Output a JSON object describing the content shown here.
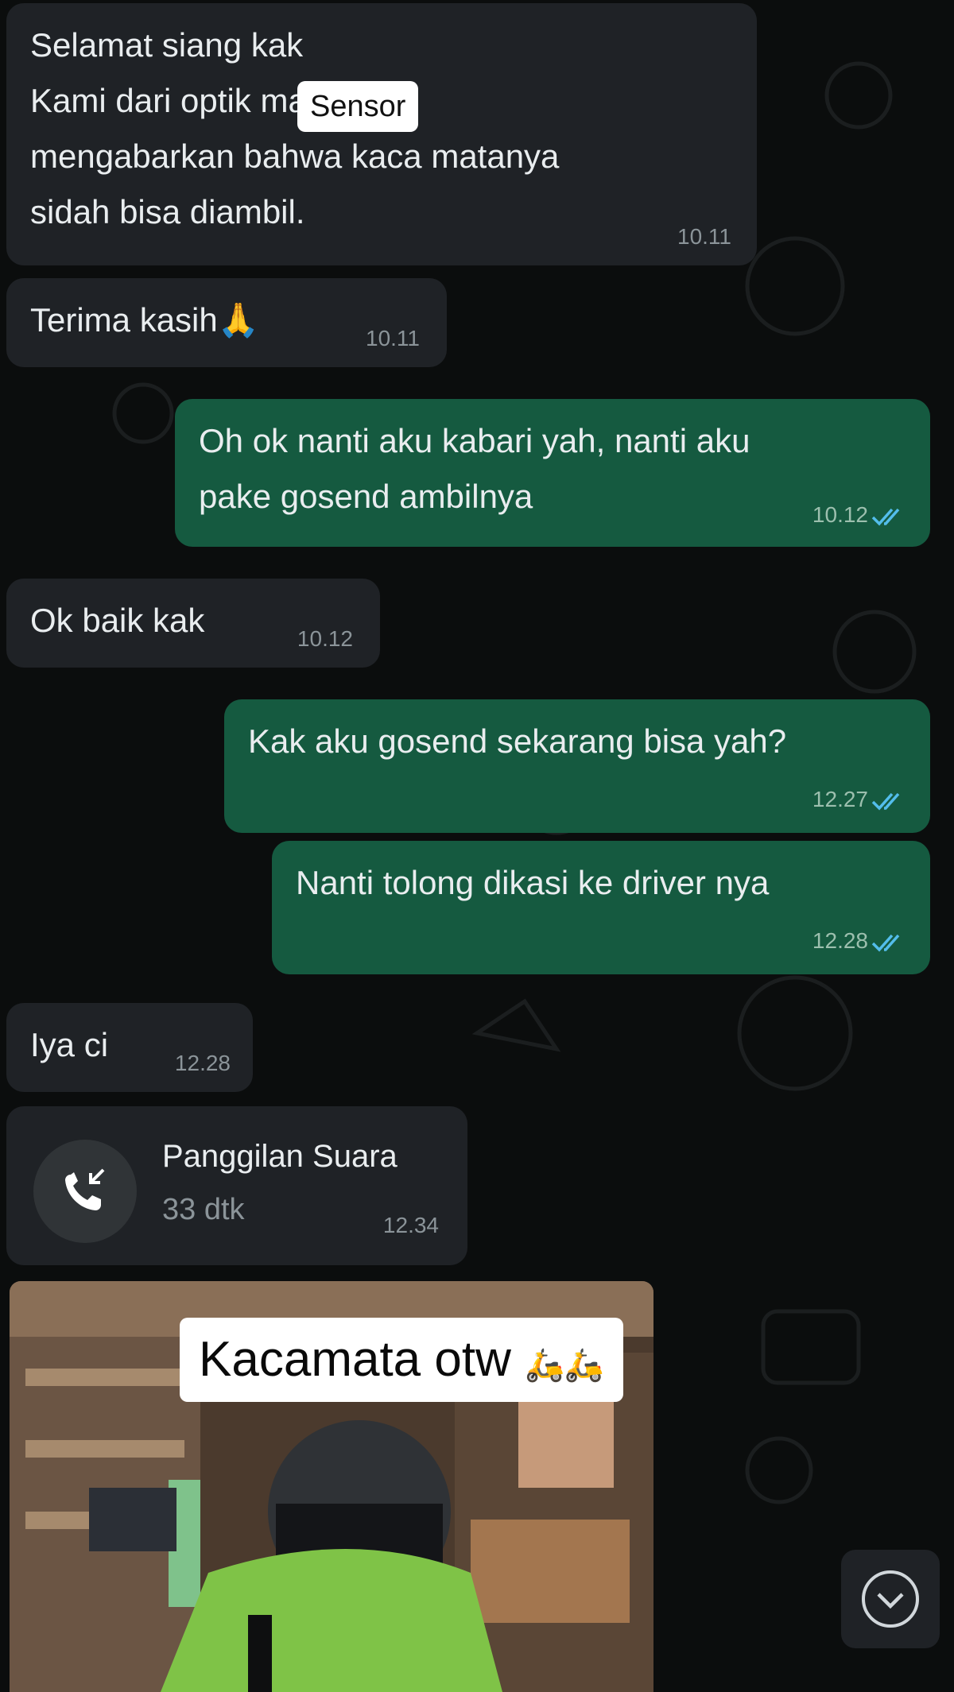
{
  "messages": [
    {
      "direction": "incoming",
      "lines": [
        "Selamat siang kak",
        "Kami dari optik",
        "mengabarkan bahwa kaca matanya",
        "sidah bisa diambil."
      ],
      "line2_suffix": "mau",
      "censor_label": "Sensor",
      "time": "10.11"
    },
    {
      "direction": "incoming",
      "text": "Terima kasih",
      "emoji": "🙏",
      "time": "10.11"
    },
    {
      "direction": "outgoing",
      "text": "Oh ok nanti aku kabari yah, nanti aku\npake gosend ambilnya",
      "time": "10.12"
    },
    {
      "direction": "incoming",
      "text": "Ok baik kak",
      "time": "10.12"
    },
    {
      "direction": "outgoing",
      "text": "Kak aku gosend sekarang bisa yah?",
      "time": "12.27"
    },
    {
      "direction": "outgoing",
      "text": "Nanti tolong dikasi ke driver nya",
      "time": "12.28"
    },
    {
      "direction": "incoming",
      "text": "Iya ci",
      "time": "12.28"
    }
  ],
  "call": {
    "title": "Panggilan Suara",
    "duration": "33 dtk",
    "time": "12.34",
    "icon": "phone-incoming-icon"
  },
  "media": {
    "caption_text": "Kacamata otw",
    "caption_emoji": "🛵🛵"
  },
  "colors": {
    "incoming": "#1f2226",
    "outgoing": "#155a40",
    "background": "#0b0d0d",
    "read_ticks": "#53bdeb"
  }
}
